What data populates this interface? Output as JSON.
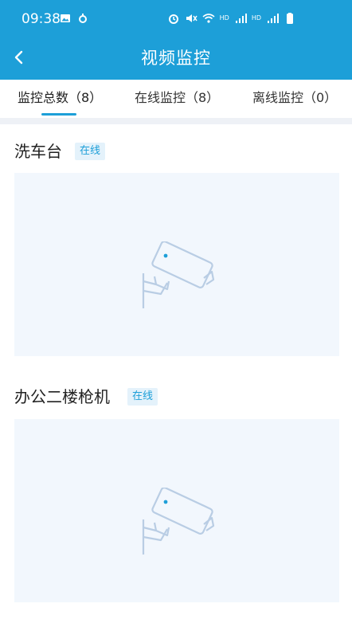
{
  "status_bar": {
    "time": "09:38",
    "left_icons": [
      "image-icon",
      "app-icon"
    ],
    "right_icons": [
      "alarm-icon",
      "mute-icon",
      "wifi-icon",
      "hd-icon",
      "signal-4g-icon",
      "hd-icon",
      "signal-4g-icon",
      "battery-icon"
    ],
    "hd_text": "HD",
    "net_text": "4G"
  },
  "header": {
    "title": "视频监控",
    "back_icon": "chevron-left-icon"
  },
  "tabs": [
    {
      "label": "监控总数（8）",
      "active": true
    },
    {
      "label": "在线监控（8）",
      "active": false
    },
    {
      "label": "离线监控（0）",
      "active": false
    }
  ],
  "cameras": [
    {
      "name": "洗车台",
      "status": "在线"
    },
    {
      "name": "办公二楼枪机",
      "status": "在线"
    }
  ],
  "colors": {
    "primary": "#1d9fd8",
    "badge_bg": "#e4f2fb",
    "video_bg": "#f2f7fd",
    "icon_stroke": "#b9cde4"
  },
  "icons": {
    "video_placeholder": "camera-icon"
  }
}
